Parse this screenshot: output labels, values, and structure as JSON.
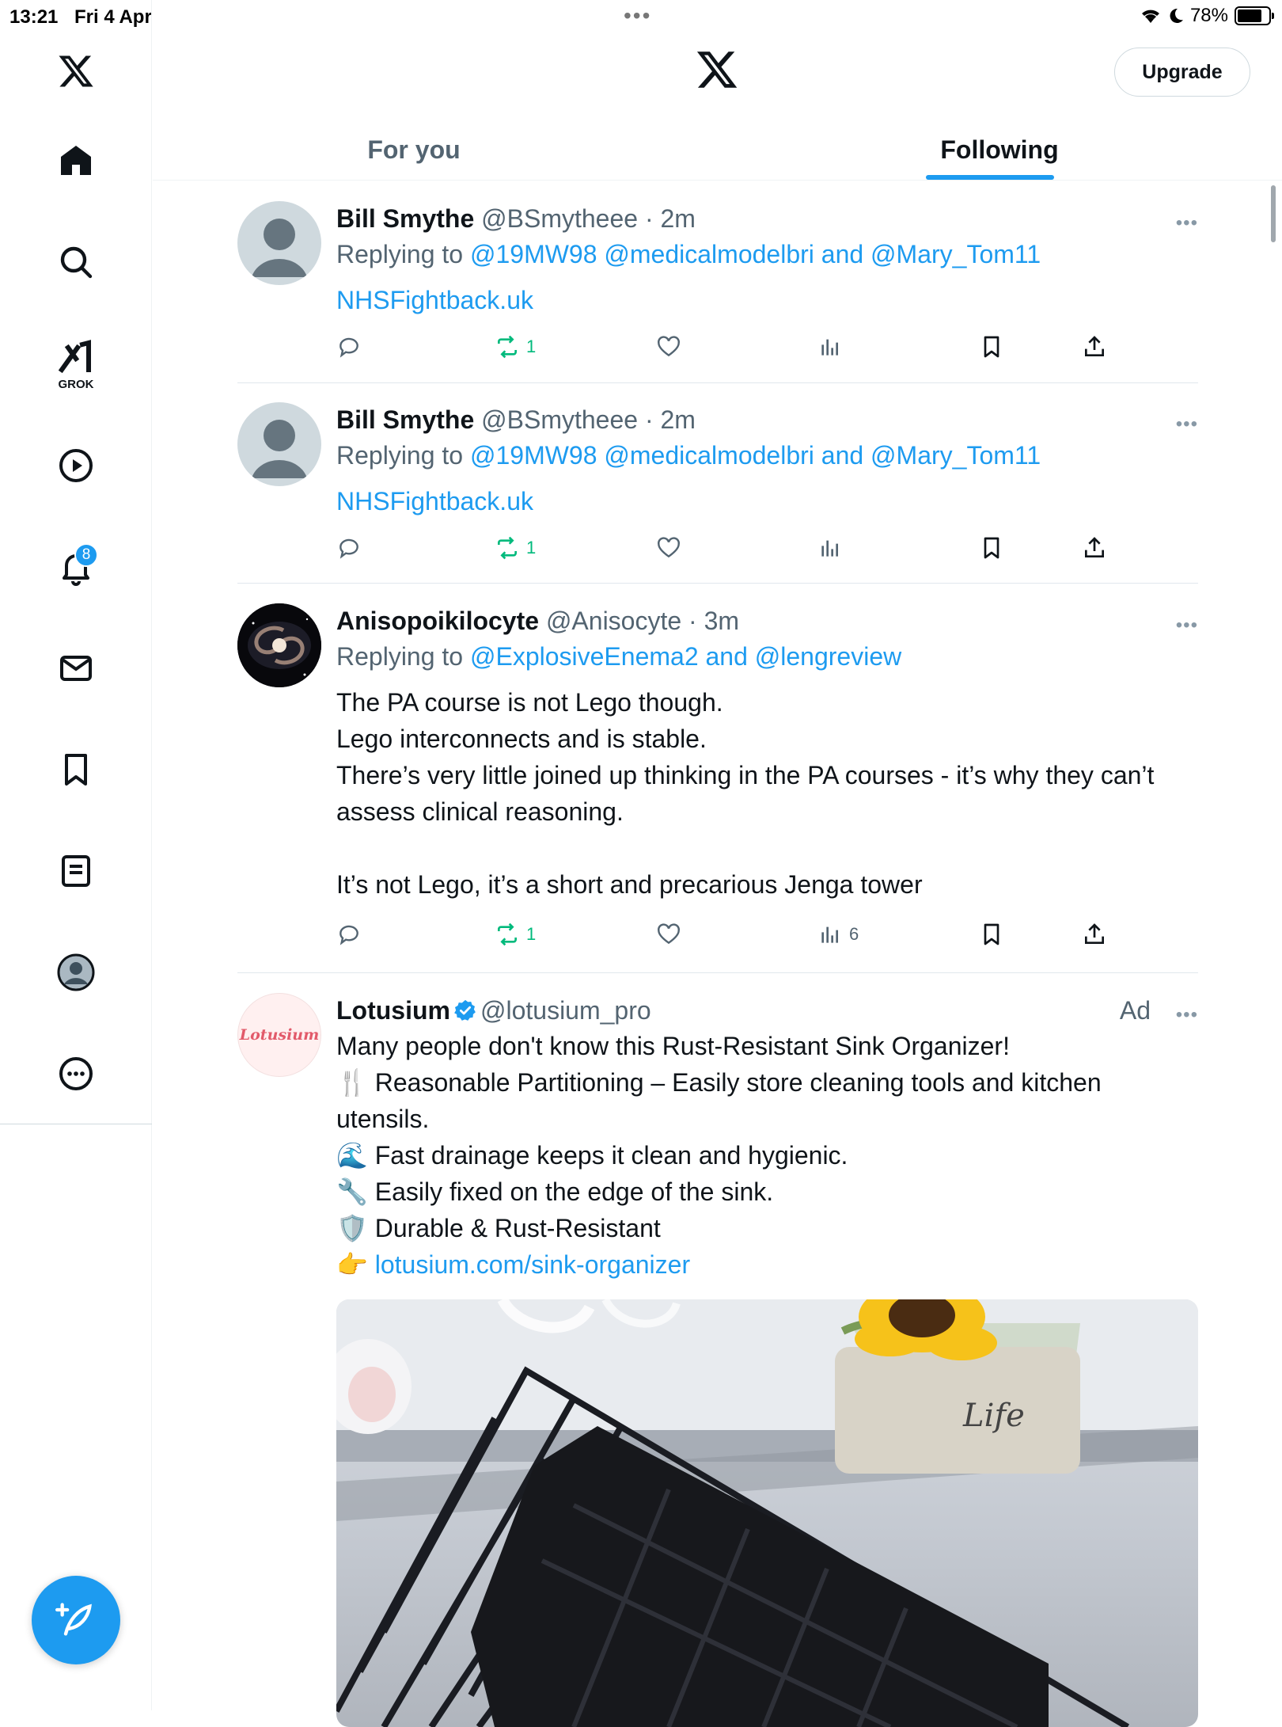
{
  "status_bar": {
    "time": "13:21",
    "date": "Fri 4 Apr",
    "battery": "78%",
    "battery_level": 0.78
  },
  "sidebar": {
    "grok_label": "GROK",
    "notifications_badge": "8"
  },
  "header": {
    "upgrade_label": "Upgrade",
    "tabs": [
      {
        "label": "For you",
        "active": false
      },
      {
        "label": "Following",
        "active": true
      }
    ]
  },
  "tweets": [
    {
      "name": "Bill Smythe",
      "handle": "@BSmytheee",
      "dot": "·",
      "time": "2m",
      "replying_prefix": "Replying to ",
      "replying_to": "@19MW98 @medicalmodelbri and @Mary_Tom11",
      "link": "NHSFightback.uk",
      "retweets": "1",
      "views": ""
    },
    {
      "name": "Bill Smythe",
      "handle": "@BSmytheee",
      "dot": "·",
      "time": "2m",
      "replying_prefix": "Replying to ",
      "replying_to": "@19MW98 @medicalmodelbri and @Mary_Tom11",
      "link": "NHSFightback.uk",
      "retweets": "1",
      "views": ""
    },
    {
      "name": "Anisopoikilocyte",
      "handle": "@Anisocyte",
      "dot": "·",
      "time": "3m",
      "replying_prefix": "Replying to ",
      "replying_to": "@ExplosiveEnema2 and @lengreview",
      "text_lines": [
        "The PA course is not Lego though.",
        "Lego interconnects and is stable.",
        "There’s very little joined up thinking in the PA courses - it’s why they can’t assess clinical reasoning.",
        "",
        "It’s not Lego, it’s a short and precarious Jenga tower"
      ],
      "retweets": "1",
      "views": "6"
    },
    {
      "name": "Lotusium",
      "handle": "@lotusium_pro",
      "ad_label": "Ad",
      "avatar_text": "Lotusium",
      "text_lines": [
        "Many people don't know this Rust-Resistant Sink Organizer!",
        "🍴 Reasonable Partitioning – Easily store cleaning tools and kitchen utensils.",
        "🌊 Fast drainage keeps it clean and hygienic.",
        "🔧 Easily fixed on the edge of the sink.",
        "🛡️ Durable & Rust-Resistant"
      ],
      "link_prefix": "👉 ",
      "link": "lotusium.com/sink-organizer",
      "image_text": "Life"
    }
  ],
  "colors": {
    "accent": "#1d9bf0",
    "retweet_green": "#00ba7c",
    "secondary_text": "#536471"
  }
}
